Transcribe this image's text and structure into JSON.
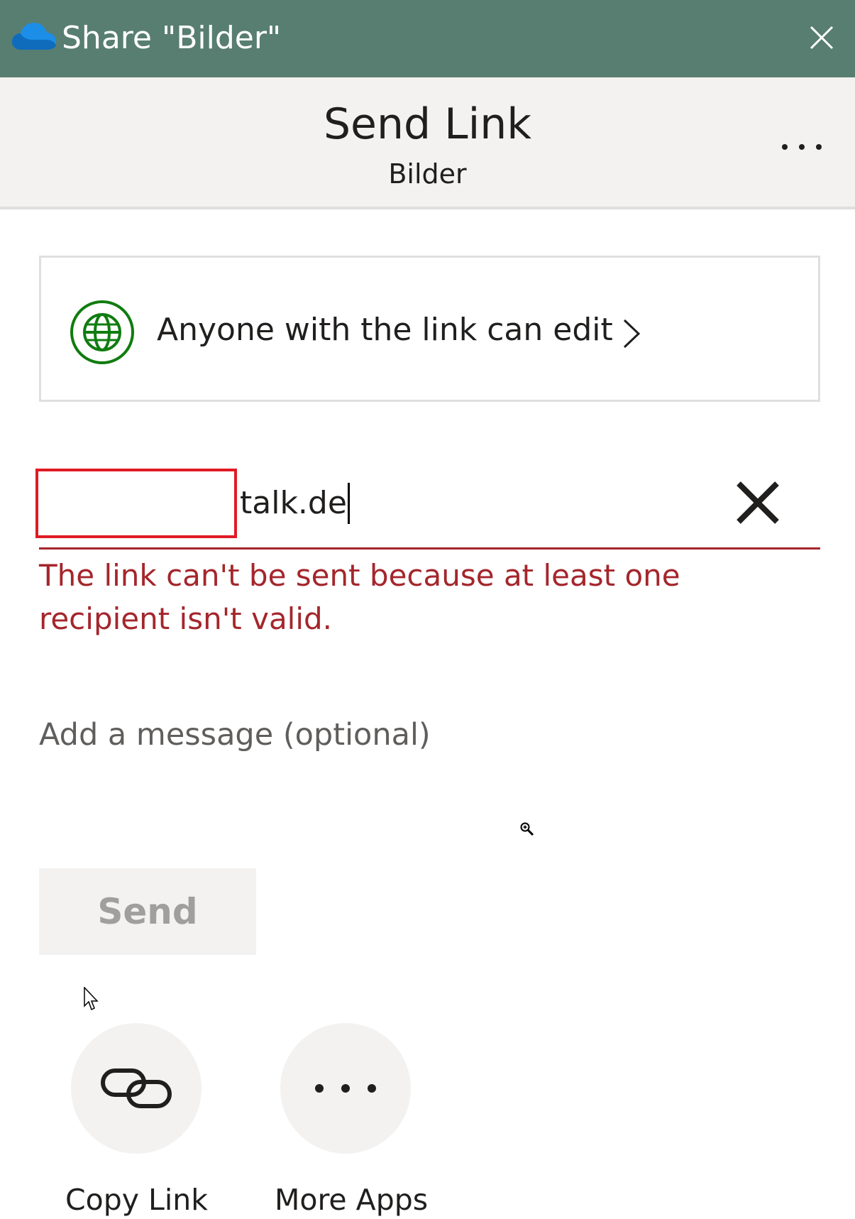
{
  "window": {
    "title": "Share \"Bilder\"",
    "app_icon": "onedrive-cloud-icon",
    "close_icon": "close-icon"
  },
  "header": {
    "title": "Send Link",
    "subtitle": "Bilder",
    "more_icon": "more-options-icon"
  },
  "permission": {
    "icon": "globe-icon",
    "label": "Anyone with the link can edit",
    "chevron_icon": "chevron-right-icon"
  },
  "recipient": {
    "value": "talk.de",
    "clear_icon": "clear-icon"
  },
  "error": {
    "text": "The link can't be sent because at least one recipient isn't valid."
  },
  "message": {
    "placeholder": "Add a message (optional)"
  },
  "actions": {
    "send_label": "Send"
  },
  "apps": [
    {
      "label": "Copy Link",
      "icon": "link-icon"
    },
    {
      "label": "More Apps",
      "icon": "more-apps-icon"
    }
  ],
  "colors": {
    "titlebar": "#587e71",
    "error": "#a4262c",
    "redaction": "#e01b24",
    "globe": "#107c10"
  }
}
